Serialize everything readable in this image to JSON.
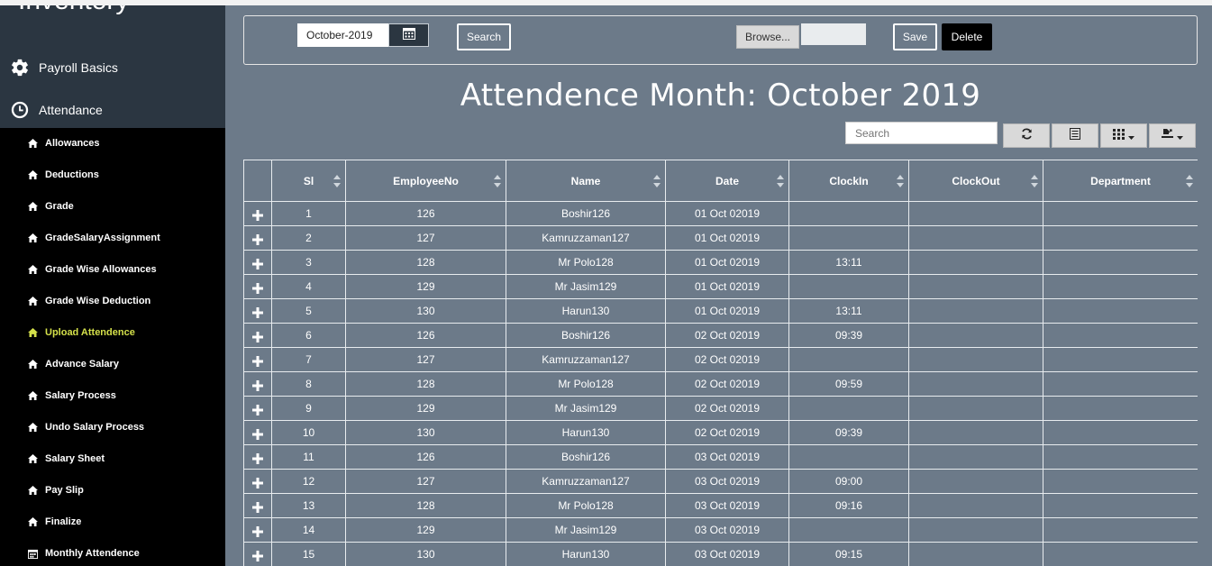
{
  "sidebar": {
    "brand": "Inventory",
    "sections": [
      {
        "label": "Payroll Basics",
        "icon": "gear-icon"
      },
      {
        "label": "Attendance",
        "icon": "clock-icon"
      }
    ],
    "items": [
      {
        "label": "Allowances",
        "icon": "home-icon",
        "active": false
      },
      {
        "label": "Deductions",
        "icon": "home-icon",
        "active": false
      },
      {
        "label": "Grade",
        "icon": "home-icon",
        "active": false
      },
      {
        "label": "GradeSalaryAssignment",
        "icon": "home-icon",
        "active": false
      },
      {
        "label": "Grade Wise Allowances",
        "icon": "home-icon",
        "active": false
      },
      {
        "label": "Grade Wise Deduction",
        "icon": "home-icon",
        "active": false
      },
      {
        "label": "Upload Attendence",
        "icon": "home-icon",
        "active": true
      },
      {
        "label": "Advance Salary",
        "icon": "home-icon",
        "active": false
      },
      {
        "label": "Salary Process",
        "icon": "home-icon",
        "active": false
      },
      {
        "label": "Undo Salary Process",
        "icon": "home-icon",
        "active": false
      },
      {
        "label": "Salary Sheet",
        "icon": "home-icon",
        "active": false
      },
      {
        "label": "Pay Slip",
        "icon": "home-icon",
        "active": false
      },
      {
        "label": "Finalize",
        "icon": "home-icon",
        "active": false
      },
      {
        "label": "Monthly Attendence",
        "icon": "calendar-icon",
        "active": false
      }
    ]
  },
  "toolbar": {
    "month_value": "October-2019",
    "search_label": "Search",
    "browse_label": "Browse...",
    "save_label": "Save",
    "delete_label": "Delete"
  },
  "page": {
    "title": "Attendence Month: October 2019",
    "table_search_placeholder": "Search"
  },
  "colors": {
    "background": "#6c7a89",
    "sidebar": "#000000",
    "sidebar_header": "#2b3641",
    "active_item": "#d4e04a"
  },
  "table": {
    "columns": [
      "Sl",
      "EmployeeNo",
      "Name",
      "Date",
      "ClockIn",
      "ClockOut",
      "Department"
    ],
    "rows": [
      [
        "1",
        "126",
        "Boshir126",
        "01 Oct 02019",
        "",
        "",
        ""
      ],
      [
        "2",
        "127",
        "Kamruzzaman127",
        "01 Oct 02019",
        "",
        "",
        ""
      ],
      [
        "3",
        "128",
        "Mr Polo128",
        "01 Oct 02019",
        "13:11",
        "",
        ""
      ],
      [
        "4",
        "129",
        "Mr Jasim129",
        "01 Oct 02019",
        "",
        "",
        ""
      ],
      [
        "5",
        "130",
        "Harun130",
        "01 Oct 02019",
        "13:11",
        "",
        ""
      ],
      [
        "6",
        "126",
        "Boshir126",
        "02 Oct 02019",
        "09:39",
        "",
        ""
      ],
      [
        "7",
        "127",
        "Kamruzzaman127",
        "02 Oct 02019",
        "",
        "",
        ""
      ],
      [
        "8",
        "128",
        "Mr Polo128",
        "02 Oct 02019",
        "09:59",
        "",
        ""
      ],
      [
        "9",
        "129",
        "Mr Jasim129",
        "02 Oct 02019",
        "",
        "",
        ""
      ],
      [
        "10",
        "130",
        "Harun130",
        "02 Oct 02019",
        "09:39",
        "",
        ""
      ],
      [
        "11",
        "126",
        "Boshir126",
        "03 Oct 02019",
        "",
        "",
        ""
      ],
      [
        "12",
        "127",
        "Kamruzzaman127",
        "03 Oct 02019",
        "09:00",
        "",
        ""
      ],
      [
        "13",
        "128",
        "Mr Polo128",
        "03 Oct 02019",
        "09:16",
        "",
        ""
      ],
      [
        "14",
        "129",
        "Mr Jasim129",
        "03 Oct 02019",
        "",
        "",
        ""
      ],
      [
        "15",
        "130",
        "Harun130",
        "03 Oct 02019",
        "09:15",
        "",
        ""
      ]
    ]
  }
}
